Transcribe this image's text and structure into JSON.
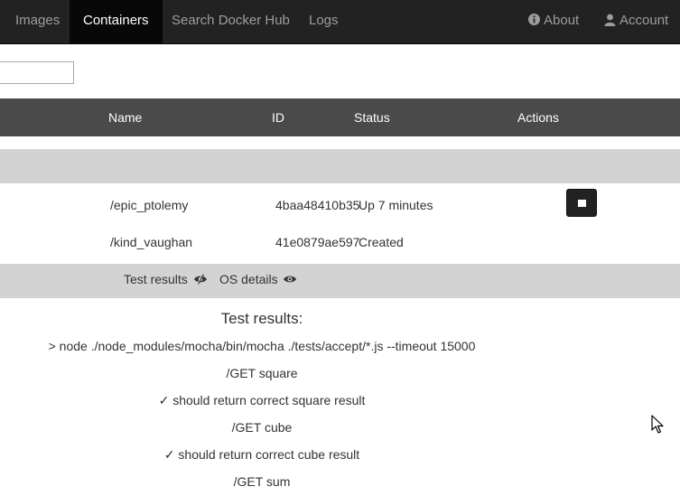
{
  "nav": {
    "items": [
      {
        "label": "Images"
      },
      {
        "label": "Containers"
      },
      {
        "label": "Search Docker Hub"
      },
      {
        "label": "Logs"
      }
    ],
    "about_label": "About",
    "about_icon": "info-circle-icon",
    "account_label": "Account",
    "account_icon": "user-icon"
  },
  "filter": {
    "value": "",
    "placeholder": ""
  },
  "table": {
    "headers": {
      "name": "Name",
      "id": "ID",
      "status": "Status",
      "actions": "Actions"
    },
    "rows": [
      {
        "name": "/epic_ptolemy",
        "id": "4baa48410b35",
        "status": "Up 7 minutes",
        "action_icon": "stop-icon"
      },
      {
        "name": "/kind_vaughan",
        "id": "41e0879ae597",
        "status": "Created"
      }
    ]
  },
  "details": {
    "test_results_label": "Test results",
    "test_results_icon": "eye-slash-icon",
    "os_details_label": "OS details",
    "os_details_icon": "eye-icon"
  },
  "results": {
    "title": "Test results:",
    "lines": [
      "> node ./node_modules/mocha/bin/mocha ./tests/accept/*.js --timeout 15000",
      "/GET square",
      "✓ should return correct square result",
      "/GET cube",
      "✓ should return correct cube result",
      "/GET sum"
    ]
  },
  "colors": {
    "navbar": "#222222",
    "active_tab": "#080808",
    "table_header": "#4a4a4a",
    "row_band": "#d3d3d3"
  }
}
